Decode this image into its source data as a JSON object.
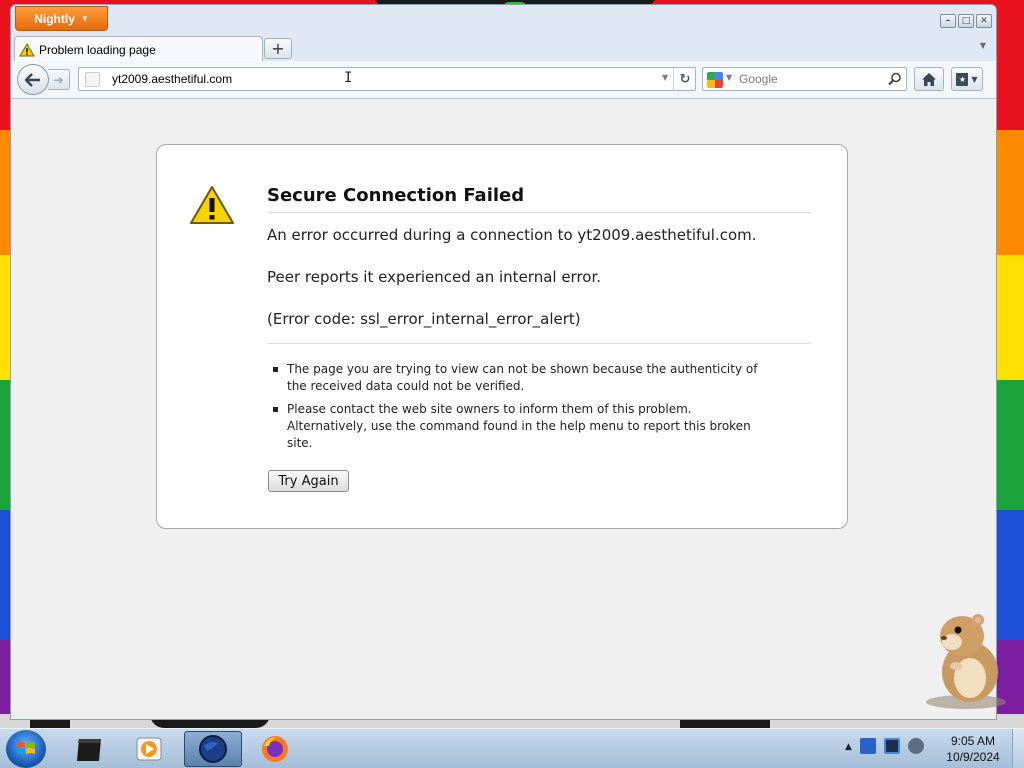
{
  "browser": {
    "app_menu_label": "Nightly",
    "tab_title": "Problem loading page",
    "url": "yt2009.aesthetiful.com",
    "search_engine": "Google",
    "search_placeholder": "Google",
    "accent_color": "#e86a0c"
  },
  "error_page": {
    "title": "Secure Connection Failed",
    "message": "An error occurred during a connection to yt2009.aesthetiful.com.",
    "detail": "Peer reports it experienced an internal error.",
    "error_code": "(Error code: ssl_error_internal_error_alert)",
    "bullets": [
      "The page you are trying to view can not be shown because the authenticity of the received data could not be verified.",
      "Please contact the web site owners to inform them of this problem. Alternatively, use the command found in the help menu to report this broken site."
    ],
    "try_again_label": "Try Again"
  },
  "taskbar": {
    "pinned": [
      "terminal-icon",
      "media-player-icon",
      "globe-browser-icon",
      "firefox-icon"
    ],
    "active_index": 2,
    "clock_time": "9:05 AM",
    "clock_date": "10/9/2024"
  }
}
